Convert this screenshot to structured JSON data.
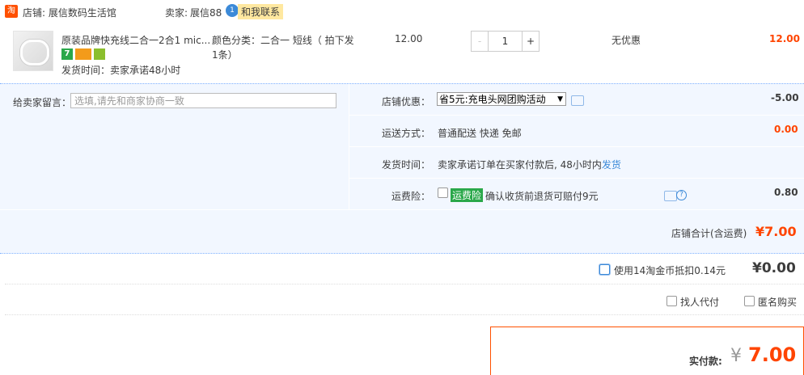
{
  "shop": {
    "logo_text": "淘",
    "label": "店铺: 展信数码生活馆",
    "seller_label": "卖家:",
    "seller_name": "展信88",
    "chat_icon": "1",
    "contact": "和我联系"
  },
  "item": {
    "title": "原装品牌快充线二合一2合1 mic...",
    "delivery": "发货时间：卖家承诺48小时",
    "badge_7": "7",
    "sku_label": "颜色分类：二合一 短线（ 拍下发",
    "sku_label2": "1条）",
    "unit_price": "12.00",
    "qty_minus": "-",
    "qty_value": "1",
    "qty_plus": "+",
    "discount": "无优惠",
    "subtotal": "12.00"
  },
  "message": {
    "label": "给卖家留言：",
    "placeholder": "选填,请先和商家协商一致"
  },
  "options": {
    "coupon_label": "店铺优惠：",
    "coupon_value": "省5元:充电头网团购活动",
    "coupon_amount": "-5.00",
    "shipping_label": "运送方式：",
    "shipping_value": "普通配送 快递 免邮",
    "shipping_amount": "0.00",
    "delivery_label": "发货时间：",
    "delivery_value": "卖家承诺订单在买家付款后, 48小时内",
    "delivery_link": "发货",
    "insurance_label": "运费险：",
    "insurance_tag": "运费险",
    "insurance_text": "确认收货前退货可赔付9元",
    "insurance_amount": "0.80"
  },
  "total": {
    "label": "店铺合计(含运费)",
    "amount": "¥7.00"
  },
  "coins": {
    "label": "使用14淘金币抵扣0.14元",
    "amount": "¥0.00"
  },
  "extras": {
    "proxy_pay": "找人代付",
    "anonymous": "匿名购买"
  },
  "payment": {
    "label": "实付款:",
    "currency": "¥",
    "amount": "7.00"
  }
}
